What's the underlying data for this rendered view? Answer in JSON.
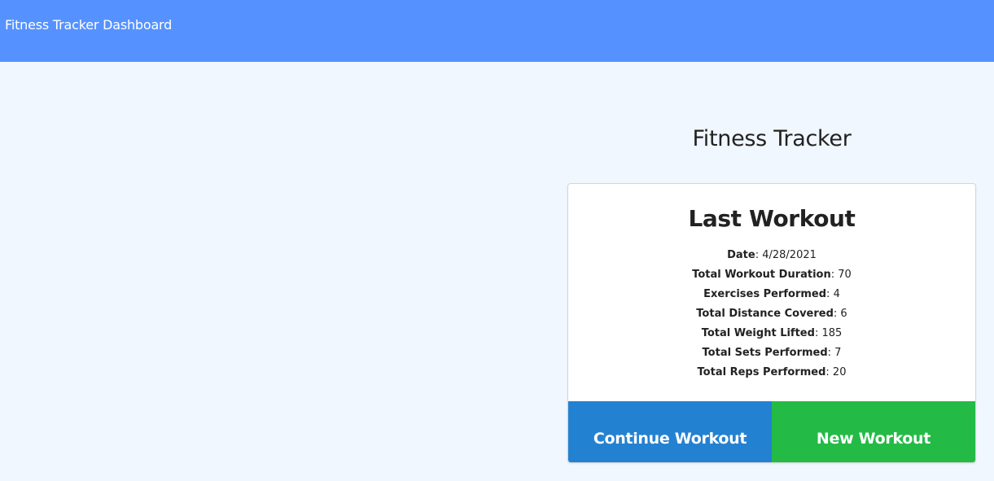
{
  "navbar": {
    "brand": "Fitness Tracker Dashboard",
    "background": "#5592ff"
  },
  "main": {
    "title": "Fitness Tracker"
  },
  "card": {
    "title": "Last Workout",
    "stats": [
      {
        "label": "Date",
        "value": "4/28/2021"
      },
      {
        "label": "Total Workout Duration",
        "value": "70"
      },
      {
        "label": "Exercises Performed",
        "value": "4"
      },
      {
        "label": "Total Distance Covered",
        "value": "6"
      },
      {
        "label": "Total Weight Lifted",
        "value": "185"
      },
      {
        "label": "Total Sets Performed",
        "value": "7"
      },
      {
        "label": "Total Reps Performed",
        "value": "20"
      }
    ],
    "continue_label": "Continue Workout",
    "new_label": "New Workout",
    "continue_color": "#2381d2",
    "new_color": "#23bb46"
  }
}
